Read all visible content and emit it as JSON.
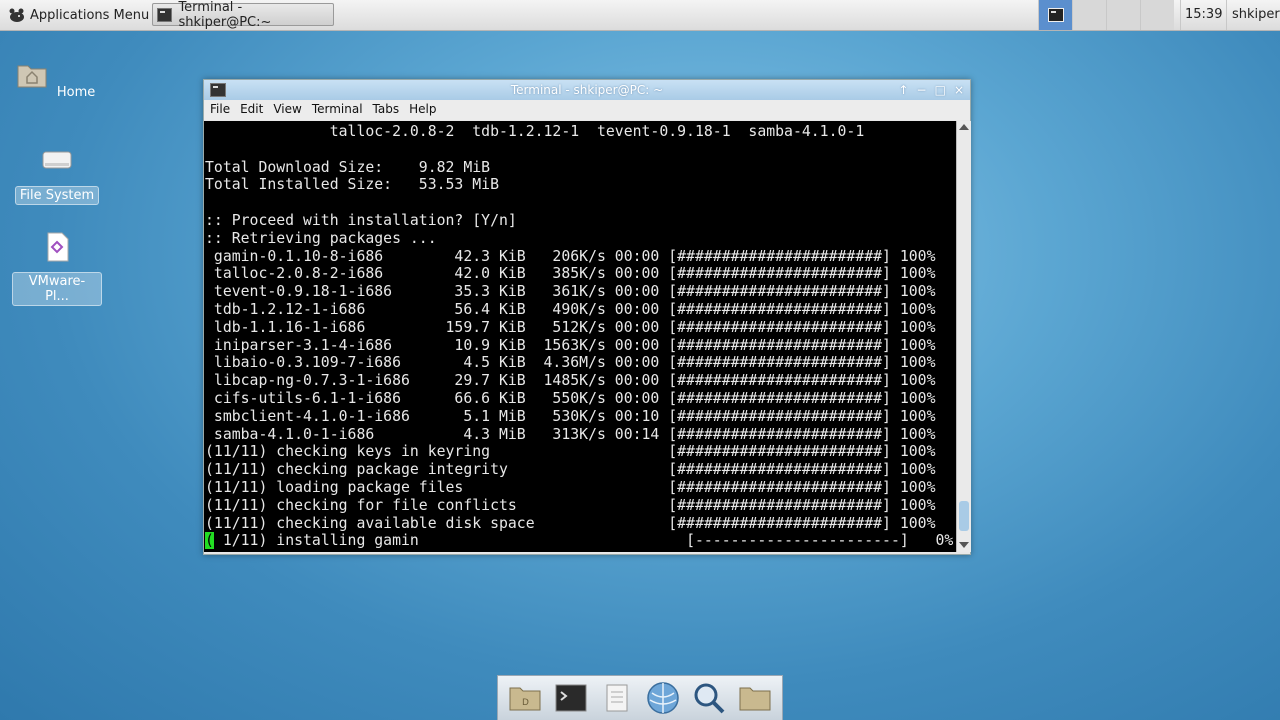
{
  "top_panel": {
    "apps_menu_label": "Applications Menu",
    "task_button_label": "Terminal - shkiper@PC:~",
    "clock": "15:39",
    "user": "shkiper"
  },
  "desktop": {
    "icons": [
      {
        "label": "Home",
        "icon": "home-folder-icon"
      },
      {
        "label": "File System",
        "icon": "drive-icon"
      },
      {
        "label": "VMware-Pl...",
        "icon": "package-icon"
      }
    ]
  },
  "window": {
    "title": "Terminal - shkiper@PC: ~",
    "menu": [
      "File",
      "Edit",
      "View",
      "Terminal",
      "Tabs",
      "Help"
    ],
    "controls": [
      "↑",
      "−",
      "□",
      "×"
    ]
  },
  "terminal": {
    "lines": [
      "              talloc-2.0.8-2  tdb-1.2.12-1  tevent-0.9.18-1  samba-4.1.0-1",
      "",
      "Total Download Size:    9.82 MiB",
      "Total Installed Size:   53.53 MiB",
      "",
      ":: Proceed with installation? [Y/n]",
      ":: Retrieving packages ...",
      " gamin-0.1.10-8-i686        42.3 KiB   206K/s 00:00 [#######################] 100%",
      " talloc-2.0.8-2-i686        42.0 KiB   385K/s 00:00 [#######################] 100%",
      " tevent-0.9.18-1-i686       35.3 KiB   361K/s 00:00 [#######################] 100%",
      " tdb-1.2.12-1-i686          56.4 KiB   490K/s 00:00 [#######################] 100%",
      " ldb-1.1.16-1-i686         159.7 KiB   512K/s 00:00 [#######################] 100%",
      " iniparser-3.1-4-i686       10.9 KiB  1563K/s 00:00 [#######################] 100%",
      " libaio-0.3.109-7-i686       4.5 KiB  4.36M/s 00:00 [#######################] 100%",
      " libcap-ng-0.7.3-1-i686     29.7 KiB  1485K/s 00:00 [#######################] 100%",
      " cifs-utils-6.1-1-i686      66.6 KiB   550K/s 00:00 [#######################] 100%",
      " smbclient-4.1.0-1-i686      5.1 MiB   530K/s 00:10 [#######################] 100%",
      " samba-4.1.0-1-i686          4.3 MiB   313K/s 00:14 [#######################] 100%",
      "(11/11) checking keys in keyring                    [#######################] 100%",
      "(11/11) checking package integrity                  [#######################] 100%",
      "(11/11) loading package files                       [#######################] 100%",
      "(11/11) checking for file conflicts                 [#######################] 100%",
      "(11/11) checking available disk space               [#######################] 100%"
    ],
    "current_line_cursor": "(",
    "current_line_rest": " 1/11) installing gamin                              [-----------------------]   0%"
  },
  "dock": {
    "items": [
      {
        "icon": "home-folder-icon"
      },
      {
        "icon": "terminal-icon"
      },
      {
        "icon": "text-editor-icon"
      },
      {
        "icon": "web-browser-icon"
      },
      {
        "icon": "search-icon"
      },
      {
        "icon": "folder-icon"
      }
    ]
  }
}
